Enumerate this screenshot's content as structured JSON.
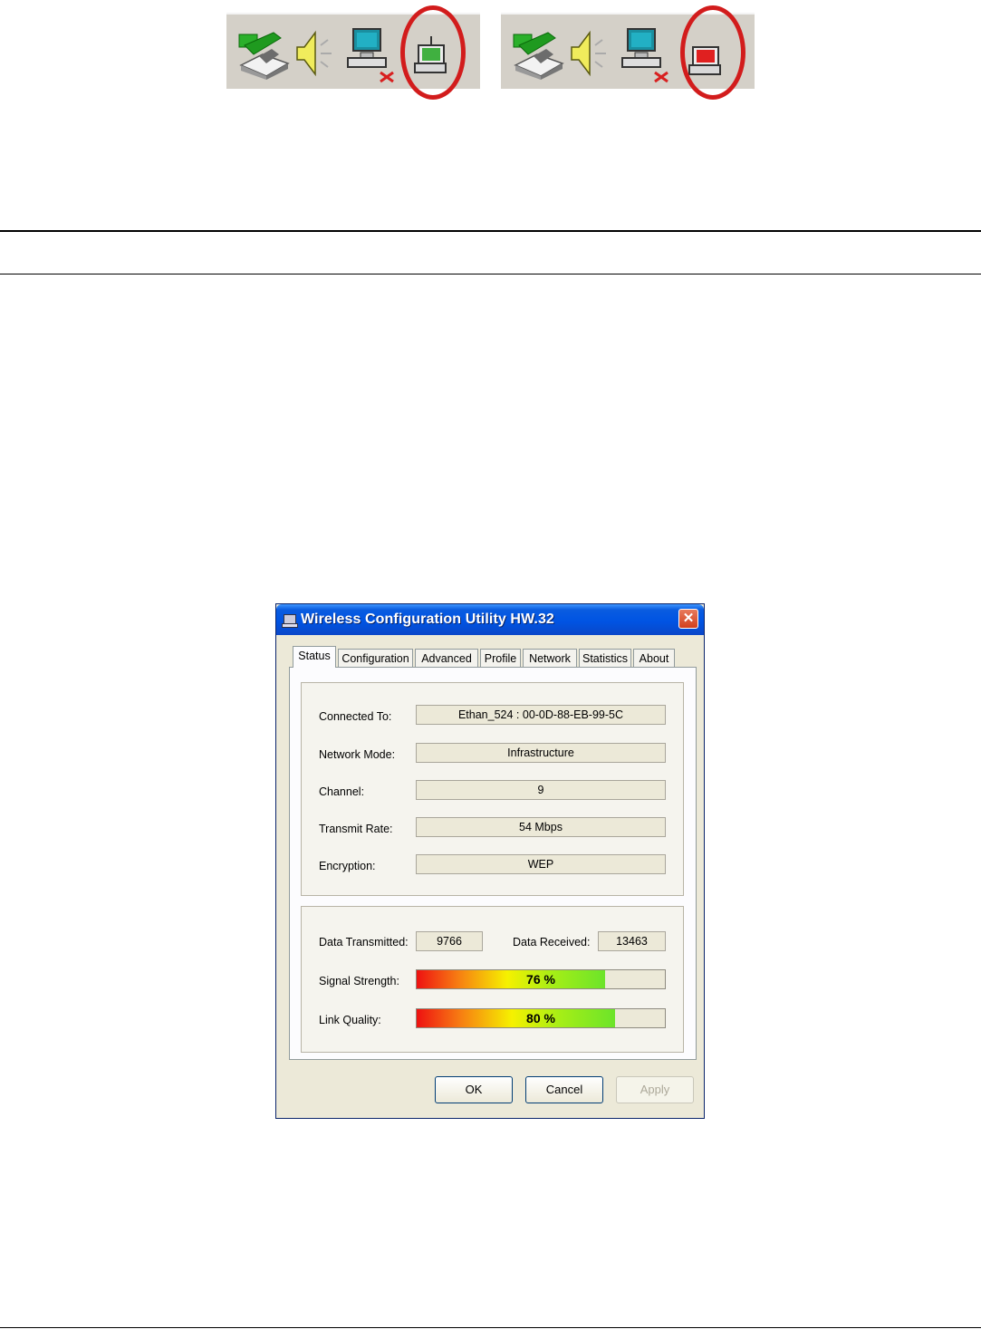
{
  "tray_left": {
    "status": "connected",
    "indicator_color": "#40b040"
  },
  "tray_right": {
    "status": "disconnected",
    "indicator_color": "#e02020"
  },
  "window": {
    "title": "Wireless Configuration Utility HW.32",
    "close_glyph": "✕"
  },
  "tabs": [
    "Status",
    "Configuration",
    "Advanced",
    "Profile",
    "Network",
    "Statistics",
    "About"
  ],
  "active_tab": "Status",
  "status": {
    "connected_to_label": "Connected To:",
    "connected_to_value": "Ethan_524 : 00-0D-88-EB-99-5C",
    "network_mode_label": "Network Mode:",
    "network_mode_value": "Infrastructure",
    "channel_label": "Channel:",
    "channel_value": "9",
    "transmit_rate_label": "Transmit Rate:",
    "transmit_rate_value": "54 Mbps",
    "encryption_label": "Encryption:",
    "encryption_value": "WEP"
  },
  "stats": {
    "data_transmitted_label": "Data Transmitted:",
    "data_transmitted_value": "9766",
    "data_received_label": "Data Received:",
    "data_received_value": "13463",
    "signal_strength_label": "Signal Strength:",
    "signal_strength_text": "76 %",
    "signal_strength_percent": 76,
    "link_quality_label": "Link Quality:",
    "link_quality_text": "80 %",
    "link_quality_percent": 80
  },
  "buttons": {
    "ok": "OK",
    "cancel": "Cancel",
    "apply": "Apply"
  },
  "colors": {
    "ring": "#d21c1c",
    "titlebar": "#0054e3"
  }
}
